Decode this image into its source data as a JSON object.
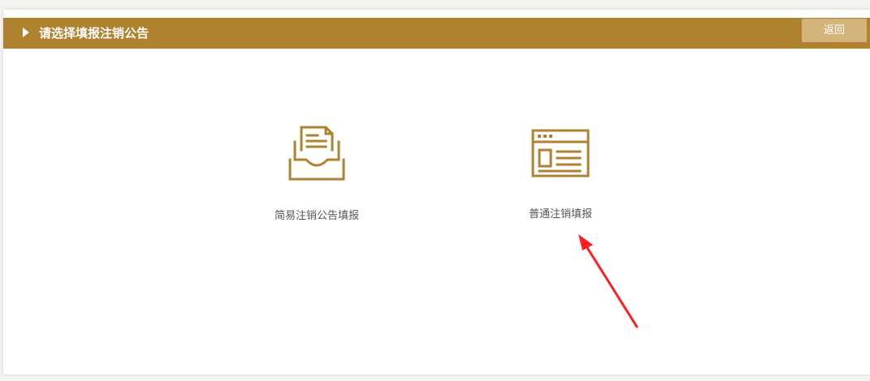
{
  "header": {
    "title": "请选择填报注销公告",
    "back_label": "返回"
  },
  "options": [
    {
      "label": "简易注销公告填报",
      "icon": "inbox-document-icon"
    },
    {
      "label": "普通注销填报",
      "icon": "browser-window-form-icon"
    }
  ],
  "colors": {
    "accent": "#ae822f",
    "button": "#d2b47c",
    "annotation": "#ff1e1e"
  }
}
